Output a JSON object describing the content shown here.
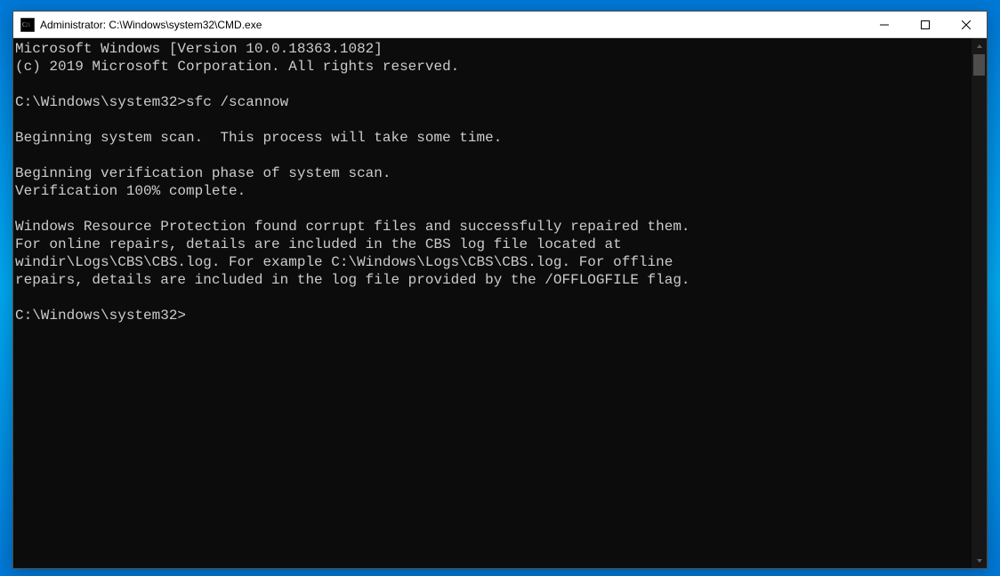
{
  "window": {
    "title": "Administrator: C:\\Windows\\system32\\CMD.exe"
  },
  "console": {
    "lines": [
      "Microsoft Windows [Version 10.0.18363.1082]",
      "(c) 2019 Microsoft Corporation. All rights reserved.",
      "",
      "C:\\Windows\\system32>sfc /scannow",
      "",
      "Beginning system scan.  This process will take some time.",
      "",
      "Beginning verification phase of system scan.",
      "Verification 100% complete.",
      "",
      "Windows Resource Protection found corrupt files and successfully repaired them.",
      "For online repairs, details are included in the CBS log file located at",
      "windir\\Logs\\CBS\\CBS.log. For example C:\\Windows\\Logs\\CBS\\CBS.log. For offline",
      "repairs, details are included in the log file provided by the /OFFLOGFILE flag.",
      "",
      "C:\\Windows\\system32>"
    ]
  },
  "icons": {
    "cmd": "cmd-icon",
    "minimize": "minimize-icon",
    "maximize": "maximize-icon",
    "close": "close-icon",
    "scroll_up": "scroll-up-icon",
    "scroll_down": "scroll-down-icon"
  }
}
